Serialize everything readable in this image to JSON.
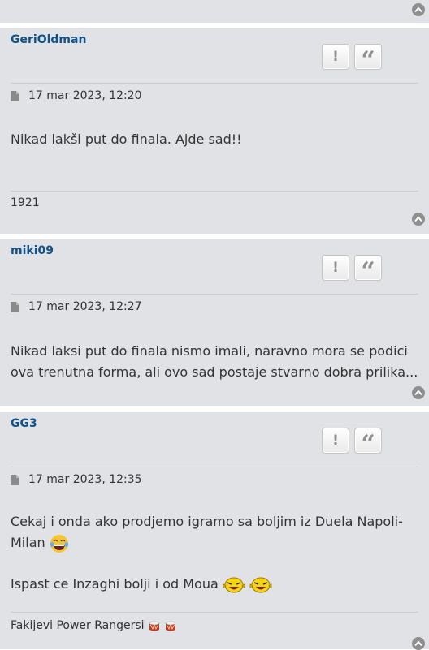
{
  "posts": [
    {
      "username": "GeriOldman",
      "date": "17 mar 2023, 12:20",
      "message": [
        "Nikad lakši put do finala. Ajde sad!!"
      ],
      "signature": "1921"
    },
    {
      "username": "miki09",
      "date": "17 mar 2023, 12:27",
      "message": [
        "Nikad laksi put do finala nismo imali, naravno mora se podici ova trenutna forma, ali ovo sad postaje stvarno dobra prilika..."
      ]
    },
    {
      "username": "GG3",
      "date": "17 mar 2023, 12:35",
      "message": [
        "Cekaj i onda ako prodjemo igramo sa boljim iz Duela Napoli-Milan",
        "Ispast ce Inzaghi bolji i od Moua"
      ],
      "signature": "Fakijevi Power Rangersi"
    }
  ],
  "buttons": {
    "report": "!",
    "quote": "“"
  },
  "icons": [
    "top-arrow-icon",
    "file-icon",
    "report-icon",
    "quote-icon",
    "laughing-emoji-icon",
    "laughing-smiley-icon",
    "drum-icon"
  ],
  "colors": {
    "post_bg": "#e1e2e6",
    "username": "#105289",
    "button_icon": "#8f8f8f"
  }
}
